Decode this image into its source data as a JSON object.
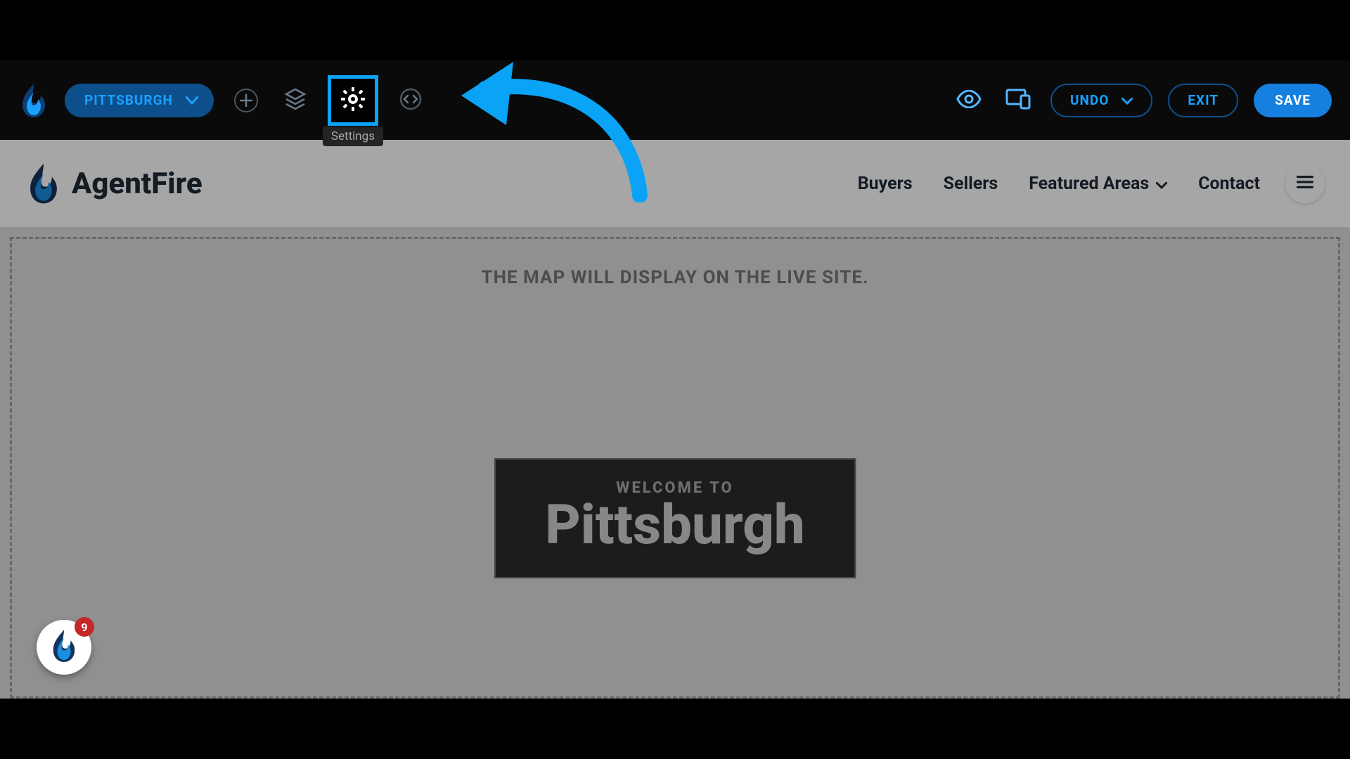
{
  "editor": {
    "pageSelector": {
      "label": "PITTSBURGH"
    },
    "tooltip": "Settings",
    "undo": "UNDO",
    "exit": "EXIT",
    "save": "SAVE",
    "icons": {
      "add": "plus-circle-icon",
      "layers": "layers-icon",
      "settings": "gear-icon",
      "code": "code-icon",
      "preview": "eye-icon",
      "devices": "devices-icon"
    }
  },
  "site": {
    "brand": "AgentFire",
    "nav": {
      "buyers": "Buyers",
      "sellers": "Sellers",
      "featured": "Featured Areas",
      "contact": "Contact"
    }
  },
  "map": {
    "placeholder": "THE MAP WILL DISPLAY ON THE LIVE SITE."
  },
  "hero": {
    "subtitle": "WELCOME TO",
    "title": "Pittsburgh"
  },
  "notifications": {
    "count": "9"
  },
  "colors": {
    "accentBlue": "#0aa3f5",
    "editorPill": "#0d4f8b",
    "saveBtn": "#1580e0"
  }
}
